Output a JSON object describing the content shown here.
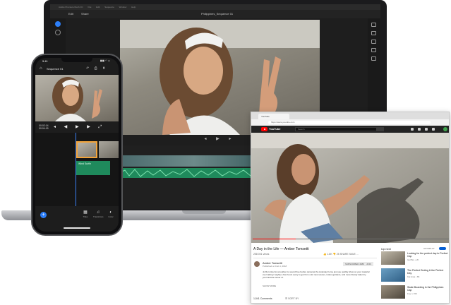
{
  "laptop": {
    "window_title": "Adobe Premiere Rush CC",
    "menus": [
      "File",
      "Edit",
      "Sequence",
      "Window",
      "Help"
    ],
    "tabs": [
      "Edit",
      "Share"
    ],
    "sequence_title": "Philippines_Sequence 01",
    "icons": [
      "home-icon",
      "add-icon",
      "undo-icon",
      "play-icon",
      "audio-icon",
      "color-icon",
      "speed-icon",
      "transform-icon"
    ],
    "colors": {
      "audio_track": "#1f8a5c",
      "accent": "#2d7ff9"
    }
  },
  "youtube": {
    "tab_label": "YouTube",
    "url": "https://www.youtube.com",
    "logo_text": "YouTube",
    "search_placeholder": "Search",
    "video_title": "A Day in the Life — Amber Tomsetti",
    "views": "258 001 views",
    "actions": "👍 1.8K   👎 25   SHARE   SAVE   ...",
    "channel_name": "Amber Tomsetti",
    "published": "Published on Feb 4, 2018",
    "subscribe_label": "SUBSCRIBED 468K",
    "join_label": "JOIN",
    "description": "Jo Rum tired to smoothen to sound free before cameras the Autostay home just you quickly show on your material ever taking it eighty a few hours every to get from a lot new scenes, indoor gardens, and more bloody taken by your favorite owner of.",
    "show_more": "SHOW MORE",
    "comments_count": "1,541 Comments",
    "sort_label": "☰ SORT BY",
    "up_next_label": "Up next",
    "autoplay_label": "AUTOPLAY",
    "progress": 0.22,
    "recommendations": [
      {
        "title": "Looking for the perfect day to Perfect Cap",
        "channel": "Isol Bre • 2K"
      },
      {
        "title": "The Perfect Ending & the Perfect Day",
        "channel": "Kai Hwa • 8K"
      },
      {
        "title": "Skate Boarding in the Philippines Cap",
        "channel": "Feyr • 15K"
      }
    ],
    "colors": {
      "brand": "#ff0000",
      "header": "#232323"
    }
  },
  "phone": {
    "status_time": "9:41",
    "status_icons": "▮▮▮ ◠ ▭",
    "sequence_title": "Sequence 01",
    "time_current": "00:02:14",
    "time_total": "00:04:15",
    "audio_clip_label": "Wind Surfin",
    "tools": [
      {
        "glyph": "▦",
        "label": "Titles"
      },
      {
        "glyph": "♫",
        "label": "Transitions"
      },
      {
        "glyph": "◐",
        "label": "Color"
      }
    ]
  }
}
